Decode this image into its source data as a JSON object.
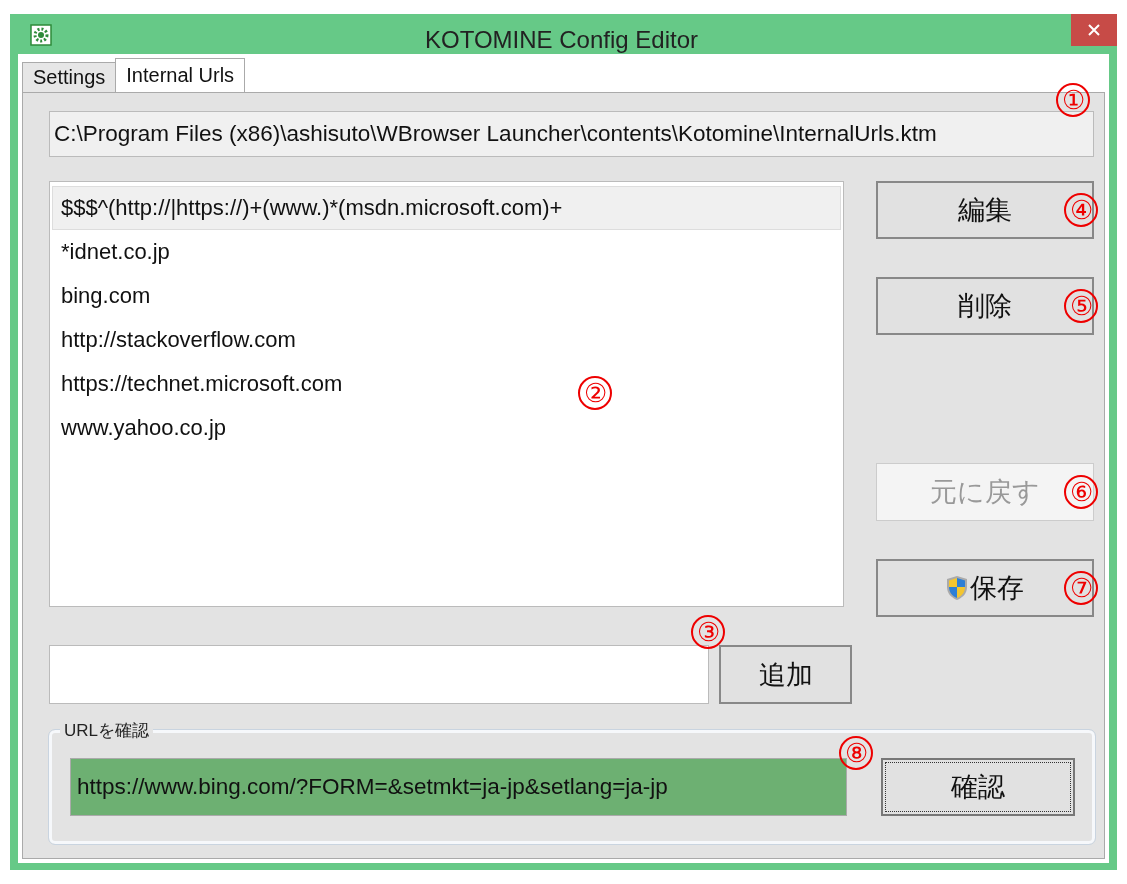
{
  "window": {
    "title": "KOTOMINE Config Editor"
  },
  "tabs": [
    {
      "label": "Settings",
      "selected": false
    },
    {
      "label": "Internal Urls",
      "selected": true
    }
  ],
  "file_path": {
    "value": "C:\\Program Files (x86)\\ashisuto\\WBrowser Launcher\\contents\\Kotomine\\InternalUrls.ktm",
    "annotation": "①"
  },
  "url_list": {
    "annotation": "②",
    "items": [
      {
        "text": "$$$^(http://|https://)+(www.)*(msdn.microsoft.com)+",
        "selected": true
      },
      {
        "text": "*idnet.co.jp",
        "selected": false
      },
      {
        "text": "bing.com",
        "selected": false
      },
      {
        "text": "http://stackoverflow.com",
        "selected": false
      },
      {
        "text": "https://technet.microsoft.com",
        "selected": false
      },
      {
        "text": "www.yahoo.co.jp",
        "selected": false
      }
    ]
  },
  "side_buttons": [
    {
      "label": "編集",
      "disabled": false,
      "shield": false,
      "annotation": "④"
    },
    {
      "label": "削除",
      "disabled": false,
      "shield": false,
      "annotation": "⑤"
    },
    {
      "label": "元に戻す",
      "disabled": true,
      "shield": false,
      "annotation": "⑥"
    },
    {
      "label": "保存",
      "disabled": false,
      "shield": true,
      "annotation": "⑦"
    }
  ],
  "add_row": {
    "button": "追加",
    "annotation": "③"
  },
  "check_group": {
    "title": "URLを確認",
    "value": "https://www.bing.com/?FORM=&setmkt=ja-jp&setlang=ja-jp",
    "button": "確認",
    "annotation": "⑧"
  }
}
